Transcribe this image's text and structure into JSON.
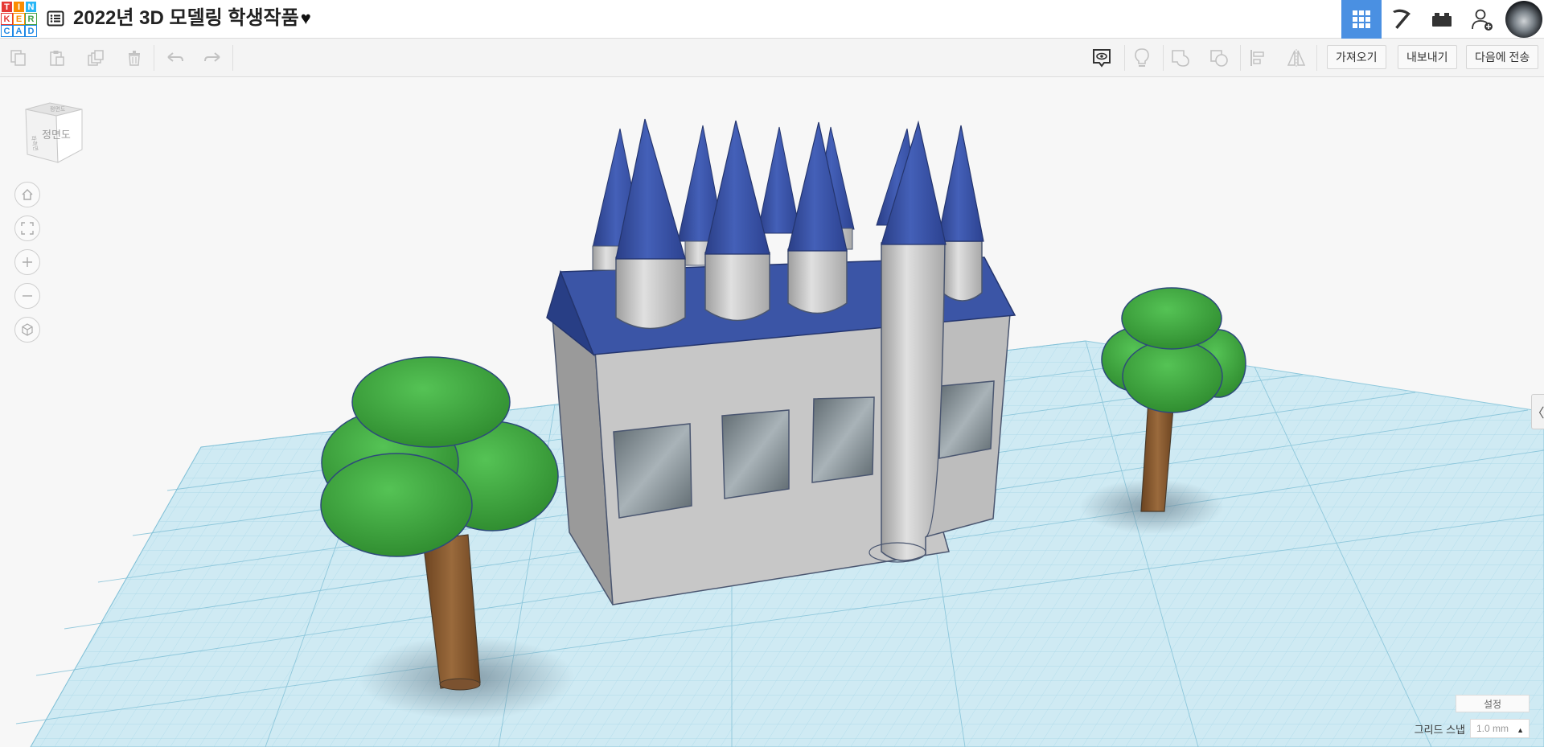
{
  "app": {
    "logo_letters": [
      "T",
      "I",
      "N",
      "K",
      "E",
      "R",
      "C",
      "A",
      "D"
    ],
    "design_title": "2022년 3D 모델링 학생작품",
    "title_heart": "♥"
  },
  "top_icons": [
    {
      "name": "3d-design-grid-icon",
      "active": true
    },
    {
      "name": "pickaxe-icon",
      "active": false
    },
    {
      "name": "brick-icon",
      "active": false
    },
    {
      "name": "add-user-icon",
      "active": false
    }
  ],
  "toolbar": {
    "import_label": "가져오기",
    "export_label": "내보내기",
    "send_to_label": "다음에 전송"
  },
  "viewcube": {
    "face_label": "정면도",
    "top_label": "평면도",
    "side_label": "좌측면"
  },
  "bottom": {
    "settings_label": "설정",
    "grid_snap_label": "그리드 스냅",
    "grid_snap_value": "1.0 mm",
    "snap_caret": "▲"
  },
  "side_toggle_glyph": "〈",
  "colors": {
    "accent": "#4a90e2",
    "roof_blue": "#3b55a6",
    "wall_gray": "#c4c4c4",
    "tree_green": "#3fa63f",
    "trunk_brown": "#8b5a2b",
    "grid_blue": "#bfe3ef"
  }
}
